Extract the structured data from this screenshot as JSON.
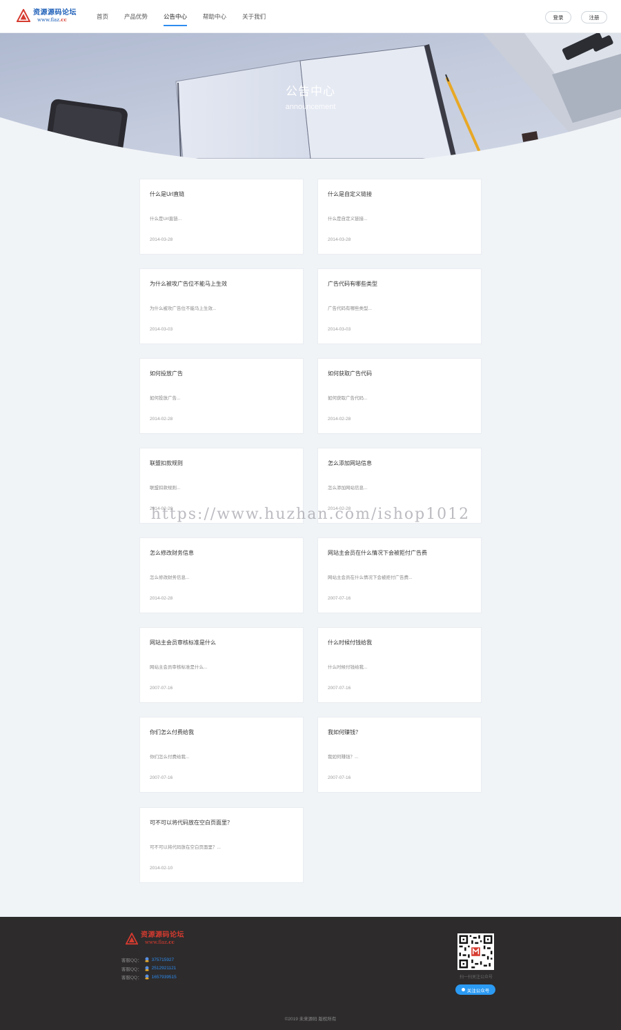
{
  "header": {
    "logo": {
      "name": "资源源码论坛",
      "url_prefix": "www.",
      "url_main": "flaz",
      "url_suffix": ".cc"
    },
    "nav": [
      {
        "label": "首页",
        "active": false
      },
      {
        "label": "产品优势",
        "active": false
      },
      {
        "label": "公告中心",
        "active": true
      },
      {
        "label": "帮助中心",
        "active": false
      },
      {
        "label": "关于我们",
        "active": false
      }
    ],
    "login_label": "登录",
    "register_label": "注册"
  },
  "banner": {
    "title": "公告中心",
    "subtitle": "announcement"
  },
  "announcements": [
    {
      "title": "什么是Url直链",
      "summary": "什么是Url直链...",
      "date": "2014-03-28"
    },
    {
      "title": "什么是自定义链接",
      "summary": "什么是自定义链接...",
      "date": "2014-03-28"
    },
    {
      "title": "为什么被攻广告位不能马上生效",
      "summary": "为什么被攻广告位不能马上生效...",
      "date": "2014-03-03"
    },
    {
      "title": "广告代码有哪些类型",
      "summary": "广告代码有哪些类型...",
      "date": "2014-03-03"
    },
    {
      "title": "如何投放广告",
      "summary": "如何投放广告...",
      "date": "2014-02-28"
    },
    {
      "title": "如何获取广告代码",
      "summary": "如何获取广告代码...",
      "date": "2014-02-28"
    },
    {
      "title": "联盟扣款规则",
      "summary": "联盟扣款规则...",
      "date": "2014-02-28"
    },
    {
      "title": "怎么添加网站信息",
      "summary": "怎么添加网站信息...",
      "date": "2014-02-28"
    },
    {
      "title": "怎么修改财务信息",
      "summary": "怎么修改财务信息...",
      "date": "2014-02-28"
    },
    {
      "title": "网站主会员在什么情况下会被拒付广告费",
      "summary": "网站主会员在什么情况下会被拒付广告费...",
      "date": "2007-07-16"
    },
    {
      "title": "网站主会员审核标准是什么",
      "summary": "网站主会员审核标准是什么...",
      "date": "2007-07-16"
    },
    {
      "title": "什么时候付钱给我",
      "summary": "什么时候付钱给我...",
      "date": "2007-07-16"
    },
    {
      "title": "你们怎么付费给我",
      "summary": "你们怎么付费给我...",
      "date": "2007-07-16"
    },
    {
      "title": "我如何赚钱？",
      "summary": "我如何赚钱？...",
      "date": "2007-07-16"
    },
    {
      "title": "可不可以将代码放在空白页面里？",
      "summary": "可不可以将代码放在空白页面里？...",
      "date": "2014-02-10"
    }
  ],
  "watermark": "https://www.huzhan.com/ishop1012",
  "footer": {
    "qq": [
      {
        "label": "客服QQ：",
        "number": "375715927"
      },
      {
        "label": "客服QQ：",
        "number": "2512921121"
      },
      {
        "label": "客服QQ：",
        "number": "1657939515"
      }
    ],
    "qr_caption": "扫一扫关注公众号",
    "follow_label": "关注公众号",
    "copyright": "©2019 未来源码 版权所有"
  },
  "colors": {
    "accent": "#2d8cf0",
    "footer_bg": "#2d2b2c",
    "page_bg": "#f1f4f7",
    "logo_blue": "#1d5fb8",
    "logo_red": "#d63b2f"
  }
}
